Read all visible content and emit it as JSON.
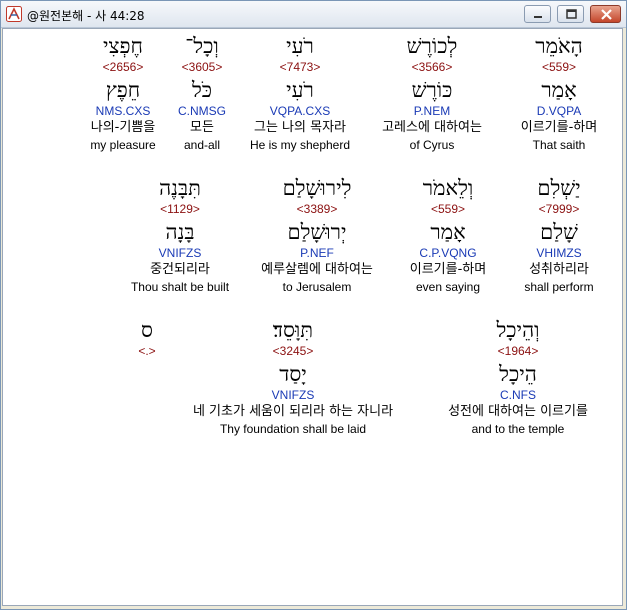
{
  "window": {
    "title": "@원전본해 - 사 44:28"
  },
  "rows": [
    {
      "name": "row-1",
      "words": [
        {
          "name": "word-haomer",
          "heb": "הָאֹמֵר",
          "strong": "<559>",
          "lemma": "אָמַר",
          "morph": "D.VQPA",
          "kor": "이르기를-하며",
          "eng": "That saith",
          "highlighted": true
        },
        {
          "name": "word-lekoresh",
          "heb": "לְכוֹרֶשׁ",
          "strong": "<3566>",
          "lemma": "כּוֹרֶשׁ",
          "morph": "P.NEM",
          "kor": "고레스에 대하여는",
          "eng": "of Cyrus"
        },
        {
          "name": "word-roi",
          "heb": "רֹעִי",
          "strong": "<7473>",
          "lemma": "רֹעִי",
          "morph": "VQPA.CXS",
          "kor": "그는 나의 목자라",
          "eng": "He is my shepherd"
        },
        {
          "name": "word-vechol",
          "heb": "וְכָל־",
          "strong": "<3605>",
          "lemma": "כֹּל",
          "morph": "C.NMSG",
          "kor": "모든",
          "eng": "and-all"
        },
        {
          "name": "word-cheftsi",
          "heb": "חֶפְצִי",
          "strong": "<2656>",
          "lemma": "חֵפֶץ",
          "morph": "NMS.CXS",
          "kor": "나의-기쁨을",
          "eng": "my pleasure"
        }
      ]
    },
    {
      "name": "row-2",
      "words": [
        {
          "name": "word-yashlim",
          "heb": "יַשְׁלִם",
          "strong": "<7999>",
          "lemma": "שָׁלַם",
          "morph": "VHIMZS",
          "kor": "성취하리라",
          "eng": "shall perform"
        },
        {
          "name": "word-velemor",
          "heb": "וְלֵאמֹר",
          "strong": "<559>",
          "lemma": "אָמַר",
          "morph": "C.P.VQNG",
          "kor": "이르기를-하며",
          "eng": "even saying"
        },
        {
          "name": "word-lirushalayim",
          "heb": "לִירוּשָׁלַם",
          "strong": "<3389>",
          "lemma": "יְרוּשָׁלַם",
          "morph": "P.NEF",
          "kor": "예루살렘에 대하여는",
          "eng": "to Jerusalem"
        },
        {
          "name": "word-tibbaneh",
          "heb": "תִּבָּנֶה",
          "strong": "<1129>",
          "lemma": "בָּנָה",
          "morph": "VNIFZS",
          "kor": "중건되리라",
          "eng": "Thou shalt be built"
        }
      ]
    },
    {
      "name": "row-3",
      "words": [
        {
          "name": "word-vehechal",
          "heb": "וְהֵיכָל",
          "strong": "<1964>",
          "lemma": "הֵיכָל",
          "morph": "C.NFS",
          "kor": "성전에 대하여는 이르기를",
          "eng": "and to the temple"
        },
        {
          "name": "word-tivvased",
          "heb": "תִּוָּסֵד׃",
          "strong": "<3245>",
          "lemma": "יָסַד",
          "morph": "VNIFZS",
          "kor": "네 기초가 세움이 되리라 하는 자니라",
          "eng": "Thy foundation shall be laid"
        },
        {
          "name": "word-samekh",
          "heb": "ס",
          "strong": "<.>",
          "lemma": "",
          "morph": "",
          "kor": "",
          "eng": ""
        }
      ]
    }
  ]
}
